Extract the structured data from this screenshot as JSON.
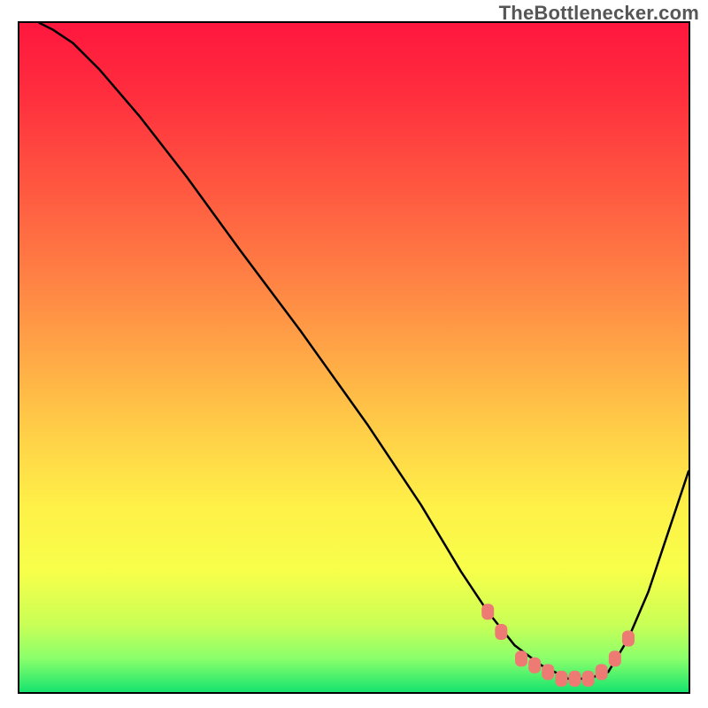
{
  "attribution": {
    "text": "TheBottlenecker.com"
  },
  "chart_data": {
    "type": "line",
    "title": "",
    "xlabel": "",
    "ylabel": "",
    "xlim": [
      0,
      100
    ],
    "ylim": [
      0,
      100
    ],
    "grid": false,
    "legend": false,
    "background_gradient": {
      "orientation": "vertical",
      "stops": [
        {
          "offset": 0.0,
          "color": "#ff173e"
        },
        {
          "offset": 0.1,
          "color": "#ff2c3e"
        },
        {
          "offset": 0.22,
          "color": "#ff5040"
        },
        {
          "offset": 0.35,
          "color": "#ff7743"
        },
        {
          "offset": 0.48,
          "color": "#ffa246"
        },
        {
          "offset": 0.6,
          "color": "#ffcb47"
        },
        {
          "offset": 0.72,
          "color": "#fff048"
        },
        {
          "offset": 0.82,
          "color": "#f7ff4a"
        },
        {
          "offset": 0.9,
          "color": "#c8ff56"
        },
        {
          "offset": 0.95,
          "color": "#8aff6c"
        },
        {
          "offset": 1.0,
          "color": "#16e46d"
        }
      ]
    },
    "series": [
      {
        "name": "bottleneck-curve",
        "color": "#000000",
        "width": 2.5,
        "x": [
          3,
          5,
          8,
          12,
          18,
          25,
          33,
          42,
          52,
          60,
          66,
          70,
          74,
          78,
          82,
          85,
          88,
          91,
          94,
          97,
          100
        ],
        "y": [
          100,
          99,
          97,
          93,
          86,
          77,
          66,
          54,
          40,
          28,
          18,
          12,
          7,
          4,
          2,
          2,
          3,
          8,
          15,
          24,
          33
        ]
      }
    ],
    "markers": {
      "name": "optimal-zone-markers",
      "color": "#ee7a74",
      "shape": "rounded-rect",
      "points": [
        {
          "x": 70,
          "y": 12
        },
        {
          "x": 72,
          "y": 9
        },
        {
          "x": 75,
          "y": 5
        },
        {
          "x": 77,
          "y": 4
        },
        {
          "x": 79,
          "y": 3
        },
        {
          "x": 81,
          "y": 2
        },
        {
          "x": 83,
          "y": 2
        },
        {
          "x": 85,
          "y": 2
        },
        {
          "x": 87,
          "y": 3
        },
        {
          "x": 89,
          "y": 5
        },
        {
          "x": 91,
          "y": 8
        }
      ]
    }
  }
}
